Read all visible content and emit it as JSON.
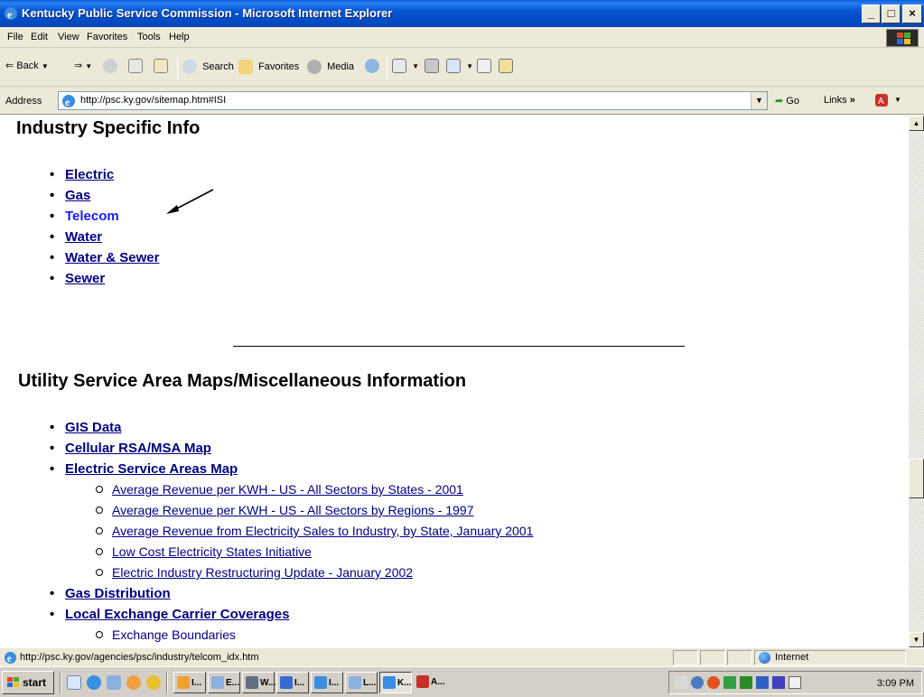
{
  "window": {
    "title": "Kentucky Public Service Commission - Microsoft Internet Explorer",
    "min": "_",
    "max": "□",
    "close": "×"
  },
  "menu": [
    "File",
    "Edit",
    "View",
    "Favorites",
    "Tools",
    "Help"
  ],
  "toolbar": {
    "back": "Back",
    "search": "Search",
    "favorites": "Favorites",
    "media": "Media"
  },
  "address": {
    "label": "Address",
    "url": "http://psc.ky.gov/sitemap.htm#ISI",
    "go": "Go",
    "links": "Links"
  },
  "content": {
    "section1_title": "Industry Specific Info",
    "industry_items": [
      "Electric",
      "Gas",
      "Telecom",
      "Water",
      "Water & Sewer",
      "Sewer"
    ],
    "section2_title": "Utility Service Area Maps/Miscellaneous Information",
    "maps_items": [
      "GIS Data",
      "Cellular RSA/MSA Map",
      "Electric Service Areas Map"
    ],
    "electric_subitems": [
      "Average Revenue per KWH - US - All Sectors by States - 2001",
      "Average Revenue per KWH - US - All Sectors by Regions - 1997",
      "Average Revenue from Electricity Sales to Industry, by State, January 2001",
      "Low Cost Electricity States Initiative",
      "Electric Industry Restructuring Update - January 2002"
    ],
    "maps_items2": [
      "Gas Distribution",
      "Local Exchange Carrier Coverages"
    ],
    "exchange_subitem": "Exchange Boundaries"
  },
  "status": {
    "text": "http://psc.ky.gov/agencies/psc/industry/telcom_idx.htm",
    "zone": "Internet"
  },
  "taskbar": {
    "start": "start",
    "tasks": [
      "I...",
      "E...",
      "W...",
      "I...",
      "I...",
      "L...",
      "K...",
      "A..."
    ],
    "clock": "3:09 PM"
  }
}
